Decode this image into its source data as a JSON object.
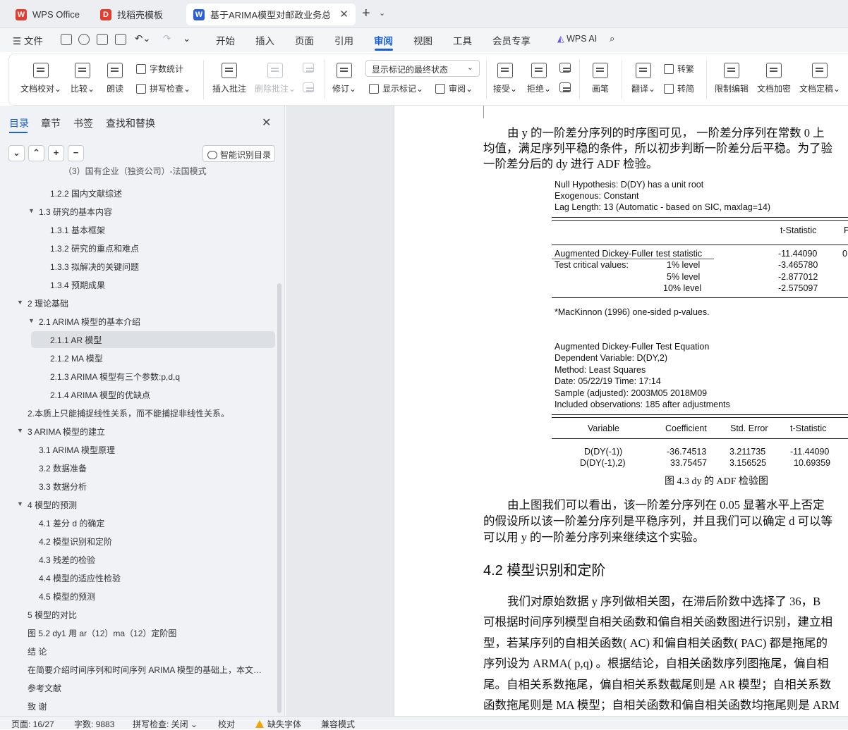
{
  "window": {
    "tabs": [
      {
        "label": "WPS Office",
        "icon": "wps-logo-icon",
        "color": "#e23d2e"
      },
      {
        "label": "找稻壳模板",
        "icon": "docer-icon",
        "color": "#e23d2e"
      },
      {
        "label": "基于ARIMA模型对邮政业务总",
        "icon": "word-doc-icon",
        "color": "#2b5fd9"
      }
    ]
  },
  "menubar": {
    "file": "文件",
    "items": [
      "开始",
      "插入",
      "页面",
      "引用",
      "审阅",
      "视图",
      "工具",
      "会员专享"
    ],
    "active": "审阅",
    "wps_ai": "WPS AI"
  },
  "ribbon": {
    "doc_check": "文档校对",
    "compare": "比较",
    "read_aloud": "朗读",
    "word_count": "字数统计",
    "spell_check": "拼写检查",
    "insert_comment": "插入批注",
    "delete_comment": "删除批注",
    "track_changes": "修订",
    "markup_select": "显示标记的最终状态",
    "show_markup": "显示标记",
    "review": "审阅",
    "accept": "接受",
    "reject": "拒绝",
    "pen": "画笔",
    "translate": "翻译",
    "to_traditional": "转繁",
    "to_simplified": "转简",
    "restrict_edit": "限制编辑",
    "encrypt": "文档加密",
    "finalize": "文档定稿"
  },
  "nav": {
    "tabs": [
      "目录",
      "章节",
      "书签",
      "查找和替换"
    ],
    "smart_toc": "智能识别目录",
    "items": [
      {
        "label": "（3）国有企业（独资公司）-法国模式",
        "level": 3
      },
      {
        "label": "1.2.2  国内文献综述",
        "level": 3
      },
      {
        "label": "1.3  研究的基本内容",
        "level": 2,
        "arrow": true
      },
      {
        "label": "1.3.1  基本框架",
        "level": 3
      },
      {
        "label": "1.3.2  研究的重点和难点",
        "level": 3
      },
      {
        "label": "1.3.3  拟解决的关键问题",
        "level": 3
      },
      {
        "label": "1.3.4  预期成果",
        "level": 3
      },
      {
        "label": "2  理论基础",
        "level": 1,
        "arrow": true
      },
      {
        "label": "2.1    ARIMA 模型的基本介绍",
        "level": 2,
        "arrow": true
      },
      {
        "label": "2.1.1    AR 模型",
        "level": 3,
        "selected": true
      },
      {
        "label": "2.1.2    MA 模型",
        "level": 3
      },
      {
        "label": "2.1.3 ARIMA 模型有三个参数:p,d,q",
        "level": 3
      },
      {
        "label": "2.1.4    ARIMA 模型的优缺点",
        "level": 3
      },
      {
        "label": "2.本质上只能捕捉线性关系，而不能捕捉非线性关系。",
        "level": 1
      },
      {
        "label": "3 ARIMA 模型的建立",
        "level": 1,
        "arrow": true
      },
      {
        "label": "3.1 ARIMA 模型原理",
        "level": 2
      },
      {
        "label": "3.2  数据准备",
        "level": 2
      },
      {
        "label": "3.3  数据分析",
        "level": 2
      },
      {
        "label": "4  模型的预测",
        "level": 1,
        "arrow": true
      },
      {
        "label": "4.1  差分 d 的确定",
        "level": 2
      },
      {
        "label": "4.2  模型识别和定阶",
        "level": 2
      },
      {
        "label": "4.3 残差的检验",
        "level": 2
      },
      {
        "label": "4.4  模型的适应性检验",
        "level": 2
      },
      {
        "label": "4.5  模型的预测",
        "level": 2
      },
      {
        "label": "5  模型的对比",
        "level": 1
      },
      {
        "label": "图 5.2 dy1  用 ar（12）ma（12）定阶图",
        "level": 1
      },
      {
        "label": "结  论",
        "level": 1
      },
      {
        "label": "在简要介绍时间序列和时间序列 ARIMA 模型的基础上，本文…",
        "level": 1
      },
      {
        "label": "参考文献",
        "level": 1
      },
      {
        "label": "致  谢",
        "level": 1
      }
    ]
  },
  "document": {
    "para1": [
      "由 y 的一阶差分序列的时序图可见，  一阶差分序列在常数 0 上",
      "均值，满足序列平稳的条件，所以初步判断一阶差分后平稳。为了验",
      "一阶差分后的 dy 进行 ADF 检验。"
    ],
    "eviews": {
      "null_hyp": "Null Hypothesis: D(DY) has a unit root",
      "exogenous": "Exogenous: Constant",
      "lag_length": "Lag Length: 13 (Automatic - based on SIC, maxlag=14)",
      "col_tstat": "t-Statistic",
      "col_prob": "P",
      "adf_label": "Augmented Dickey-Fuller test statistic",
      "adf_t": "-11.44090",
      "adf_p": "0.",
      "crit_label": "Test critical values:",
      "crit": [
        {
          "level": "1% level",
          "value": "-3.465780"
        },
        {
          "level": "5% level",
          "value": "-2.877012"
        },
        {
          "level": "10% level",
          "value": "-2.575097"
        }
      ],
      "note": "*MacKinnon (1996) one-sided p-values.",
      "eq_title": "Augmented Dickey-Fuller Test Equation",
      "dep_var": "Dependent Variable: D(DY,2)",
      "method": "Method: Least Squares",
      "date": "Date: 05/22/19   Time: 17:14",
      "sample": "Sample (adjusted): 2003M05 2018M09",
      "obs": "Included observations: 185 after adjustments",
      "coef_headers": [
        "Variable",
        "Coefficient",
        "Std. Error",
        "t-Statistic"
      ],
      "coef_rows": [
        [
          "D(DY(-1))",
          "-36.74513",
          "3.211735",
          "-11.44090"
        ],
        [
          "D(DY(-1),2)",
          "33.75457",
          "3.156525",
          "10.69359"
        ]
      ]
    },
    "caption": "图 4.3 dy 的 ADF 检验图",
    "para2": [
      "由上图我们可以看出，该一阶差分序列在 0.05 显著水平上否定",
      "的假设所以该一阶差分序列是平稳序列，并且我们可以确定 d 可以等",
      "可以用 y 的一阶差分序列来继续这个实验。"
    ],
    "heading": "4.2  模型识别和定阶",
    "para3": [
      "我们对原始数据 y 序列做相关图，在滞后阶数中选择了 36，B",
      "可根据时间序列模型自相关函数和偏自相关函数图进行识别，建立相",
      "型，若某序列的自相关函数( AC)  和偏自相关函数( PAC)  都是拖尾的",
      "序列设为  ARMA( p,q)  。根据结论，自相关函数序列图拖尾，偏自相",
      "尾。自相关系数拖尾，偏自相关系数截尾则是 AR 模型；自相关系数",
      "函数拖尾则是 MA 模型；自相关函数和偏自相关函数均拖尾则是 ARM"
    ]
  },
  "status": {
    "page": "页面: 16/27",
    "words": "字数: 9883",
    "spell": "拼写检查: 关闭",
    "proof": "校对",
    "missing_font": "缺失字体",
    "compat": "兼容模式"
  }
}
